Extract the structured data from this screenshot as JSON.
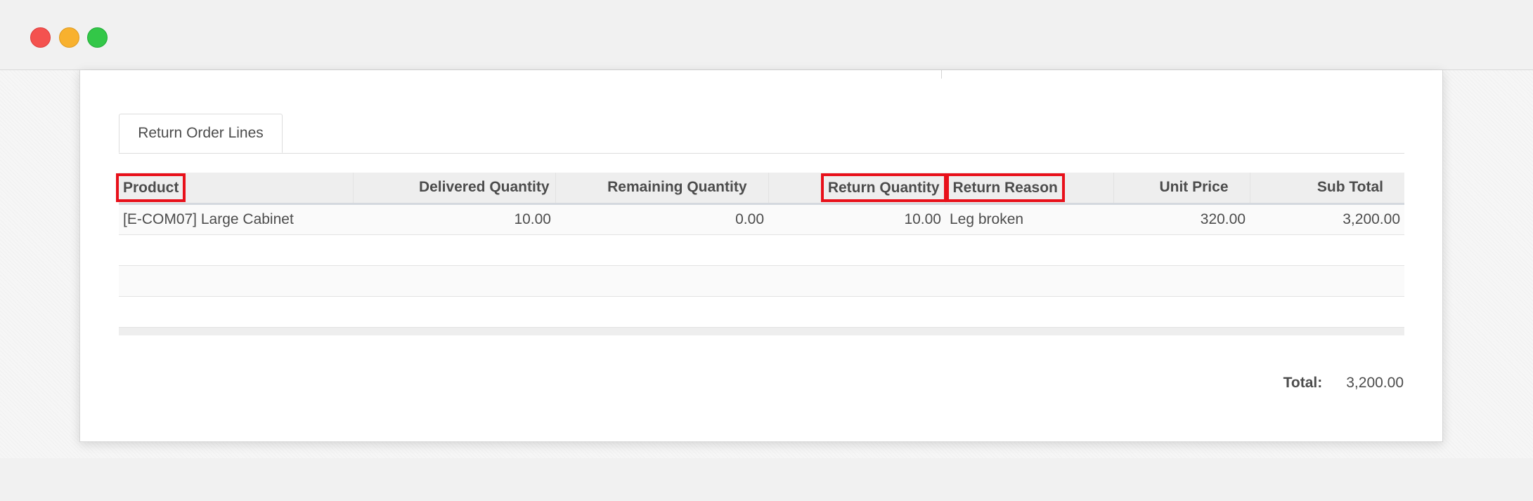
{
  "tabs": [
    {
      "label": "Return Order Lines"
    }
  ],
  "table": {
    "headers": {
      "product": "Product",
      "delivered_qty": "Delivered Quantity",
      "remaining_qty": "Remaining Quantity",
      "return_qty": "Return Quantity",
      "return_reason": "Return Reason",
      "unit_price": "Unit Price",
      "sub_total": "Sub Total"
    },
    "rows": [
      {
        "product": "[E-COM07] Large Cabinet",
        "delivered_qty": "10.00",
        "remaining_qty": "0.00",
        "return_qty": "10.00",
        "return_reason": "Leg broken",
        "unit_price": "320.00",
        "sub_total": "3,200.00"
      }
    ],
    "highlighted_columns": [
      "Product",
      "Return Quantity",
      "Return Reason"
    ]
  },
  "summary": {
    "total_label": "Total:",
    "total_value": "3,200.00"
  },
  "colors": {
    "highlight": "#e8101a",
    "header_bg": "#eeeeee",
    "text": "#4c4c4c"
  }
}
